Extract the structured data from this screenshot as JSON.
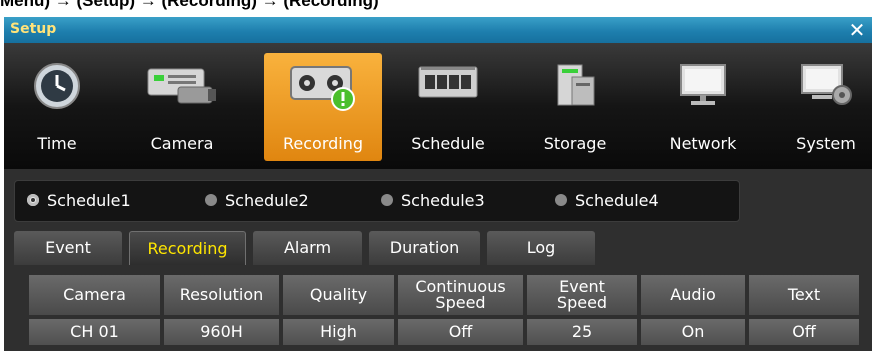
{
  "caption": "Menu) → (Setup) → (Recording) → (Recording)",
  "window": {
    "title": "Setup",
    "close_glyph": "✕"
  },
  "toolbar": {
    "items": [
      {
        "label": "Time",
        "icon": "clock-icon"
      },
      {
        "label": "Camera",
        "icon": "camera-icon"
      },
      {
        "label": "Recording",
        "icon": "recording-icon",
        "active": true
      },
      {
        "label": "Schedule",
        "icon": "schedule-icon"
      },
      {
        "label": "Storage",
        "icon": "storage-icon"
      },
      {
        "label": "Network",
        "icon": "network-icon"
      },
      {
        "label": "System",
        "icon": "system-icon"
      }
    ]
  },
  "schedules": [
    {
      "label": "Schedule1",
      "selected": true
    },
    {
      "label": "Schedule2",
      "selected": false
    },
    {
      "label": "Schedule3",
      "selected": false
    },
    {
      "label": "Schedule4",
      "selected": false
    }
  ],
  "tabs": [
    {
      "label": "Event",
      "active": false
    },
    {
      "label": "Recording",
      "active": true
    },
    {
      "label": "Alarm",
      "active": false
    },
    {
      "label": "Duration",
      "active": false
    },
    {
      "label": "Log",
      "active": false
    }
  ],
  "table": {
    "headers": [
      [
        "Camera"
      ],
      [
        "Resolution"
      ],
      [
        "Quality"
      ],
      [
        "Continuous",
        "Speed"
      ],
      [
        "Event",
        "Speed"
      ],
      [
        "Audio"
      ],
      [
        "Text"
      ]
    ],
    "rows": [
      [
        "CH 01",
        "960H",
        "High",
        "Off",
        "25",
        "On",
        "Off"
      ]
    ]
  },
  "colors": {
    "accent": "#f0a030",
    "active_tab_text": "#ffe600",
    "title_text": "#ffe37a",
    "titlebar": "#1e7fae"
  }
}
